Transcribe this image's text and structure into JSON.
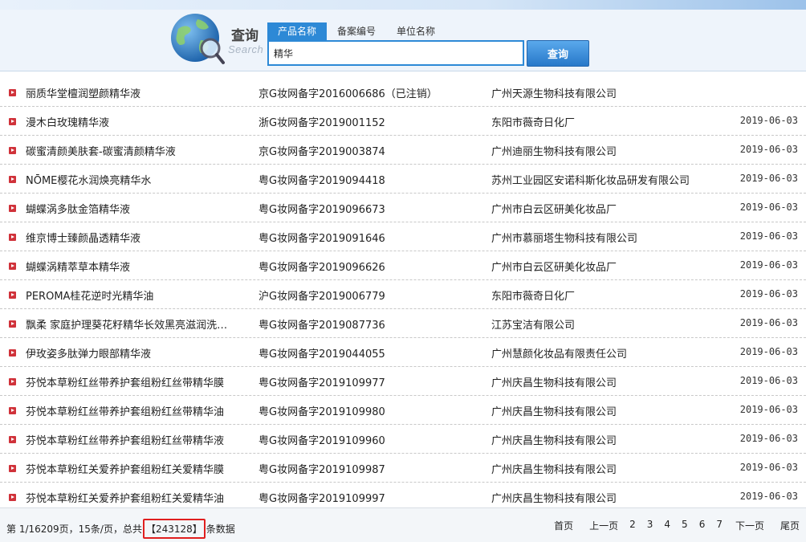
{
  "header": {
    "logo_title": "查询",
    "logo_sub": "Search",
    "tabs": [
      "产品名称",
      "备案编号",
      "单位名称"
    ],
    "search_value": "精华",
    "search_button": "查询",
    "colors": {
      "accent": "#2d89d6",
      "bullet": "#d0323a",
      "highlight_box": "#e01f1f"
    }
  },
  "rows": [
    {
      "name": "丽质华堂檀润塑颜精华液",
      "reg": "京G妆网备字2016006686（已注销）",
      "company": "广州天源生物科技有限公司",
      "date": ""
    },
    {
      "name": "漫木白玫瑰精华液",
      "reg": "浙G妆网备字2019001152",
      "company": "东阳市薇奇日化厂",
      "date": "2019-06-03"
    },
    {
      "name": "碳蜜清颜美肤套-碳蜜清颜精华液",
      "reg": "京G妆网备字2019003874",
      "company": "广州迪丽生物科技有限公司",
      "date": "2019-06-03"
    },
    {
      "name": "NŌME樱花水润焕亮精华水",
      "reg": "粤G妆网备字2019094418",
      "company": "苏州工业园区安诺科斯化妆品研发有限公司",
      "date": "2019-06-03"
    },
    {
      "name": "蝴蝶涡多肽金箔精华液",
      "reg": "粤G妆网备字2019096673",
      "company": "广州市白云区研美化妆品厂",
      "date": "2019-06-03"
    },
    {
      "name": "维京博士臻颜晶透精华液",
      "reg": "粤G妆网备字2019091646",
      "company": "广州市慕丽塔生物科技有限公司",
      "date": "2019-06-03"
    },
    {
      "name": "蝴蝶涡精萃草本精华液",
      "reg": "粤G妆网备字2019096626",
      "company": "广州市白云区研美化妆品厂",
      "date": "2019-06-03"
    },
    {
      "name": "PEROMA桂花逆时光精华油",
      "reg": "沪G妆网备字2019006779",
      "company": "东阳市薇奇日化厂",
      "date": "2019-06-03"
    },
    {
      "name": "飘柔 家庭护理葵花籽精华长效黑亮滋润洗…",
      "reg": "粤G妆网备字2019087736",
      "company": "江苏宝洁有限公司",
      "date": "2019-06-03"
    },
    {
      "name": "伊玫姿多肽弹力眼部精华液",
      "reg": "粤G妆网备字2019044055",
      "company": "广州慧颜化妆品有限责任公司",
      "date": "2019-06-03"
    },
    {
      "name": "芬悦本草粉红丝带养护套组粉红丝带精华膜",
      "reg": "粤G妆网备字2019109977",
      "company": "广州庆昌生物科技有限公司",
      "date": "2019-06-03"
    },
    {
      "name": "芬悦本草粉红丝带养护套组粉红丝带精华油",
      "reg": "粤G妆网备字2019109980",
      "company": "广州庆昌生物科技有限公司",
      "date": "2019-06-03"
    },
    {
      "name": "芬悦本草粉红丝带养护套组粉红丝带精华液",
      "reg": "粤G妆网备字2019109960",
      "company": "广州庆昌生物科技有限公司",
      "date": "2019-06-03"
    },
    {
      "name": "芬悦本草粉红关爱养护套组粉红关爱精华膜",
      "reg": "粤G妆网备字2019109987",
      "company": "广州庆昌生物科技有限公司",
      "date": "2019-06-03"
    },
    {
      "name": "芬悦本草粉红关爱养护套组粉红关爱精华油",
      "reg": "粤G妆网备字2019109997",
      "company": "广州庆昌生物科技有限公司",
      "date": "2019-06-03"
    }
  ],
  "footer": {
    "page_info_prefix": "第 1/16209页，15条/页，总共",
    "total": "【243128】",
    "page_info_suffix": "条数据",
    "pager": [
      "首页",
      "上一页",
      "2",
      "3",
      "4",
      "5",
      "6",
      "7",
      "下一页",
      "尾页"
    ]
  }
}
